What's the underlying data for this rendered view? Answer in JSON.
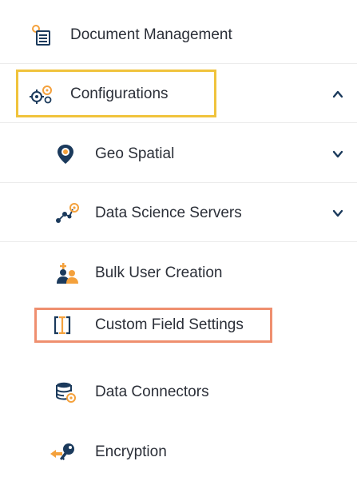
{
  "sidebar": {
    "items": [
      {
        "label": "Document Management",
        "icon": "document-management-icon"
      },
      {
        "label": "Configurations",
        "icon": "gears-icon",
        "expanded": true
      },
      {
        "label": "Geo Spatial",
        "icon": "map-pin-icon",
        "expanded": false
      },
      {
        "label": "Data Science Servers",
        "icon": "network-nodes-icon",
        "expanded": false
      },
      {
        "label": "Bulk User Creation",
        "icon": "user-group-add-icon"
      },
      {
        "label": "Custom Field Settings",
        "icon": "text-field-cursor-icon"
      },
      {
        "label": "Data Connectors",
        "icon": "database-connector-icon"
      },
      {
        "label": "Encryption",
        "icon": "key-icon"
      }
    ]
  },
  "colors": {
    "highlight_primary": "#f0c33c",
    "highlight_secondary": "#ef8f6f",
    "icon_orange": "#f4a13c",
    "icon_blue": "#1b3a5c"
  }
}
